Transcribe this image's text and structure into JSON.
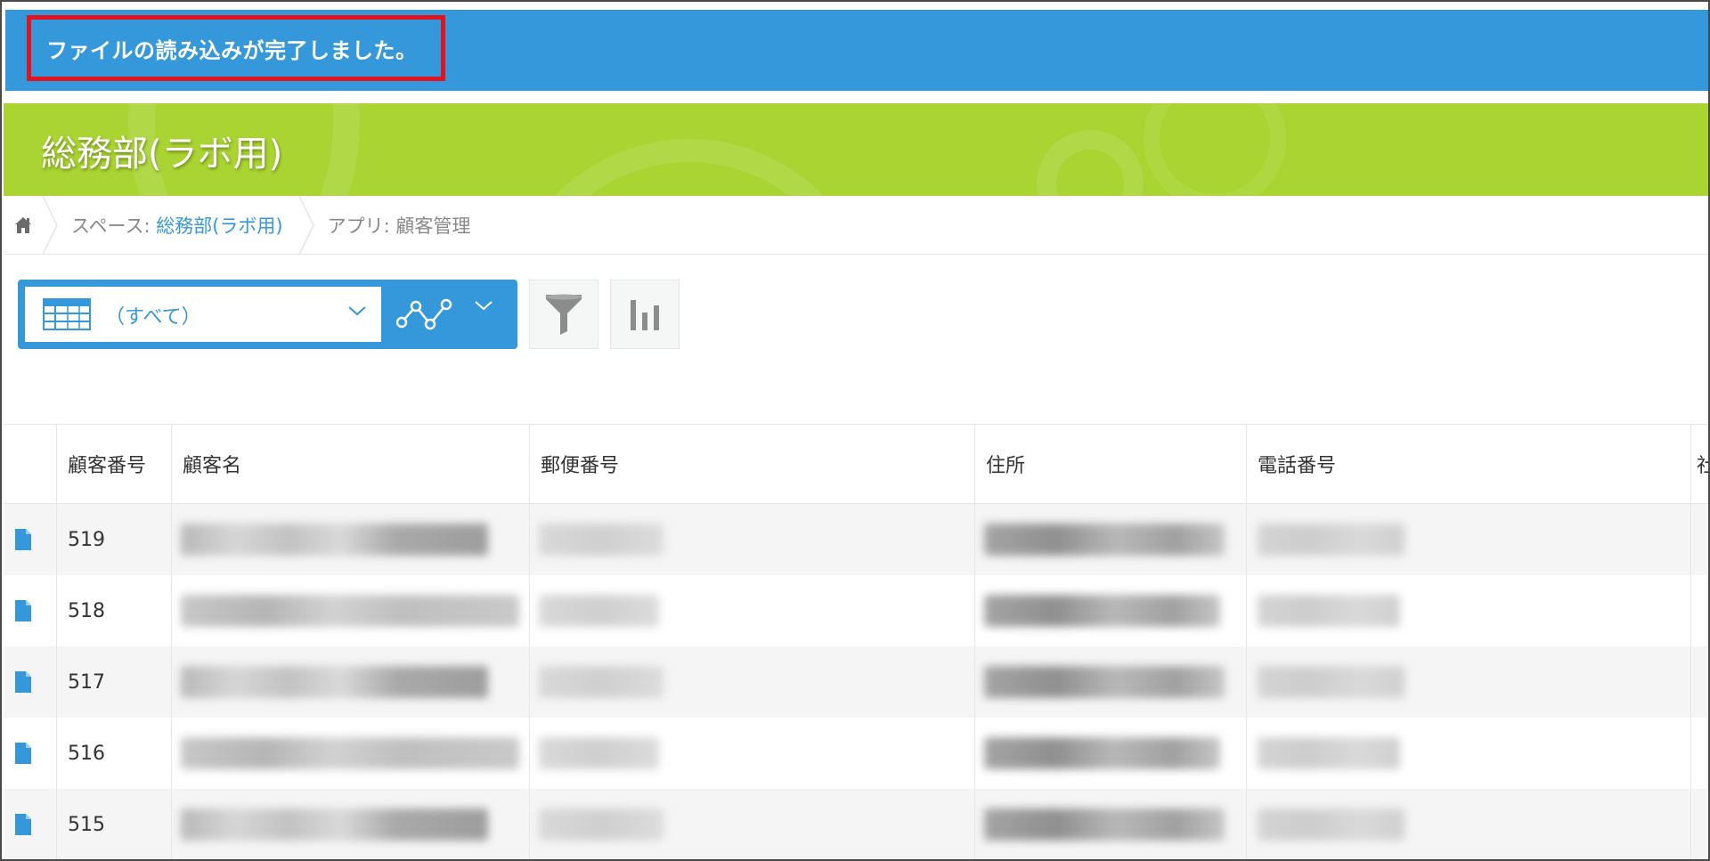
{
  "notification": {
    "message": "ファイルの読み込みが完了しました。",
    "bar_color": "#3498db",
    "highlight_color": "#e0141e"
  },
  "space": {
    "title": "総務部(ラボ用)",
    "header_color": "#a9d431"
  },
  "breadcrumb": {
    "home_icon": "home-icon",
    "space_prefix": "スペース: ",
    "space_name": "総務部(ラボ用)",
    "app_label": "アプリ: 顧客管理"
  },
  "toolbar": {
    "view_icon": "table-icon",
    "view_name": "（すべて）",
    "graph_icon": "line-graph-icon",
    "filter_icon": "filter-icon",
    "chart_icon": "bar-chart-icon"
  },
  "table": {
    "headers": [
      "顧客番号",
      "顧客名",
      "郵便番号",
      "住所",
      "電話番号",
      "社"
    ],
    "rows": [
      {
        "id": "519"
      },
      {
        "id": "518"
      },
      {
        "id": "517"
      },
      {
        "id": "516"
      },
      {
        "id": "515"
      }
    ],
    "row_icon": "document-icon"
  }
}
